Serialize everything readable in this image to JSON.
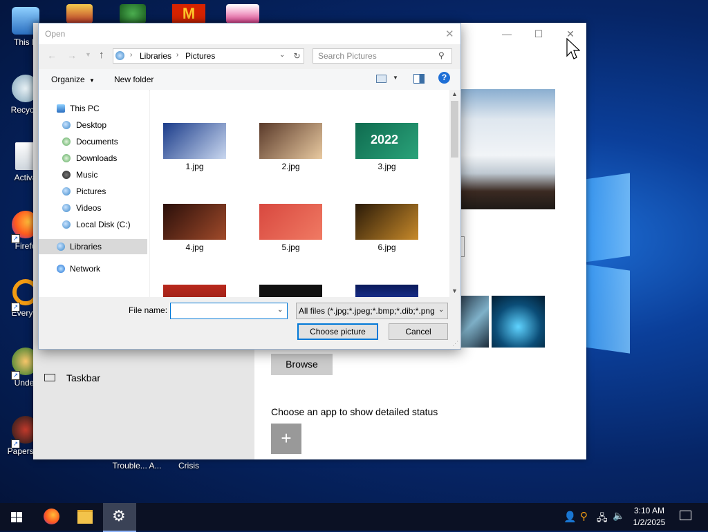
{
  "desktop": {
    "icons_left": [
      {
        "label": "This P"
      },
      {
        "label": "Recycle"
      },
      {
        "label": "Activa"
      },
      {
        "label": "Firefo"
      },
      {
        "label": "Everyth"
      },
      {
        "label": "Under"
      },
      {
        "label": "Papers, P"
      }
    ],
    "icons_bottom": [
      {
        "label": "Trouble... A..."
      },
      {
        "label": "Crisis"
      }
    ]
  },
  "settings_window": {
    "nav_item": "Taskbar",
    "browse_label": "Browse",
    "detailed_status_label": "Choose an app to show detailed status",
    "add_symbol": "+",
    "minimize": "—",
    "maximize": "☐",
    "close": "✕"
  },
  "open_dialog": {
    "title": "Open",
    "breadcrumb": [
      "Libraries",
      "Pictures"
    ],
    "search_placeholder": "Search Pictures",
    "toolbar": {
      "organize": "Organize",
      "new_folder": "New folder"
    },
    "nav": [
      {
        "label": "This PC"
      },
      {
        "label": "Desktop"
      },
      {
        "label": "Documents"
      },
      {
        "label": "Downloads"
      },
      {
        "label": "Music"
      },
      {
        "label": "Pictures"
      },
      {
        "label": "Videos"
      },
      {
        "label": "Local Disk (C:)"
      },
      {
        "label": "Libraries"
      },
      {
        "label": "Network"
      }
    ],
    "files": [
      {
        "name": "1.jpg",
        "color_a": "#1b3c8a",
        "color_b": "#c9d7ef"
      },
      {
        "name": "2.jpg",
        "color_a": "#5a3a2a",
        "color_b": "#e8c9a0"
      },
      {
        "name": "3.jpg",
        "color_a": "#0f6b4f",
        "color_b": "#2aa37a"
      },
      {
        "name": "4.jpg",
        "color_a": "#2a0f0a",
        "color_b": "#a04a2a"
      },
      {
        "name": "5.jpg",
        "color_a": "#d8483f",
        "color_b": "#f07a63"
      },
      {
        "name": "6.jpg",
        "color_a": "#2a1a08",
        "color_b": "#c88a2a"
      }
    ],
    "file_name_label": "File name:",
    "file_name_value": "",
    "filter_value": "All files (*.jpg;*.jpeg;*.bmp;*.dib;*.png",
    "choose_button": "Choose picture",
    "cancel_button": "Cancel"
  },
  "taskbar": {
    "time": "3:10 AM",
    "date": "1/2/2025"
  }
}
